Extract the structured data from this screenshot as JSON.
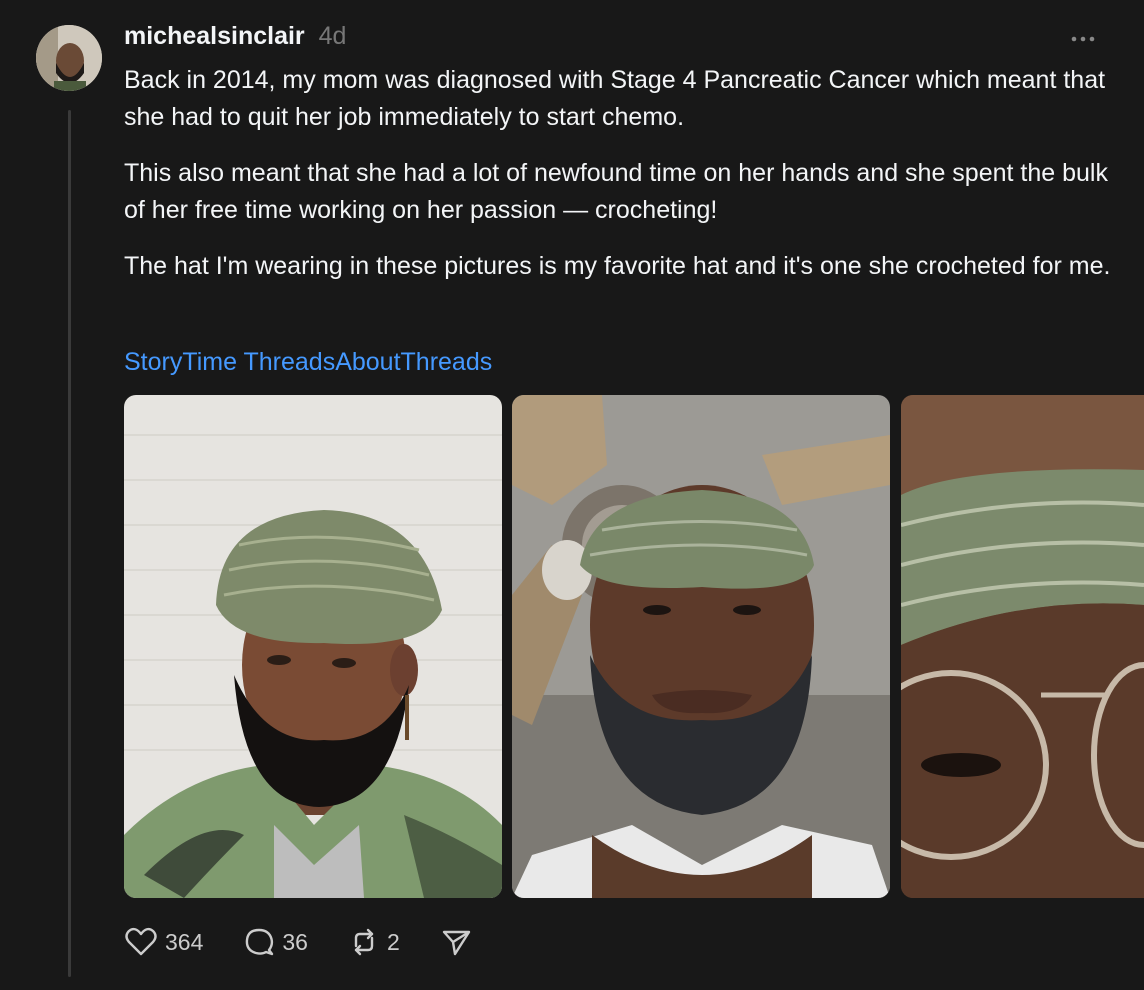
{
  "post": {
    "username": "michealsinclair",
    "timestamp": "4d",
    "paragraphs": [
      "Back in 2014, my mom was diagnosed with Stage 4 Pancreatic Cancer which meant that she had to quit her job immediately to start chemo.",
      "This also meant that she had a lot of newfound time on her hands and she spent the bulk of her free time working on her passion — crocheting!",
      "The hat I'm wearing in these pictures is my favorite hat and it's one she crocheted for me."
    ],
    "tags": [
      "StoryTime",
      "ThreadsAboutThreads"
    ],
    "photos": [
      "photo-selfie-tie-dye",
      "photo-selfie-ceiling-fan",
      "photo-closeup-glasses"
    ]
  },
  "actions": {
    "likes": "364",
    "replies": "36",
    "reposts": "2"
  },
  "icons": {
    "avatar": "avatar",
    "more": "more-icon",
    "like": "heart-icon",
    "reply": "comment-icon",
    "repost": "repost-icon",
    "share": "send-icon"
  },
  "colors": {
    "background": "#181818",
    "text": "#f3f5f7",
    "muted": "#777777",
    "link": "#4599ff",
    "thread_line": "#3a3a3a"
  }
}
